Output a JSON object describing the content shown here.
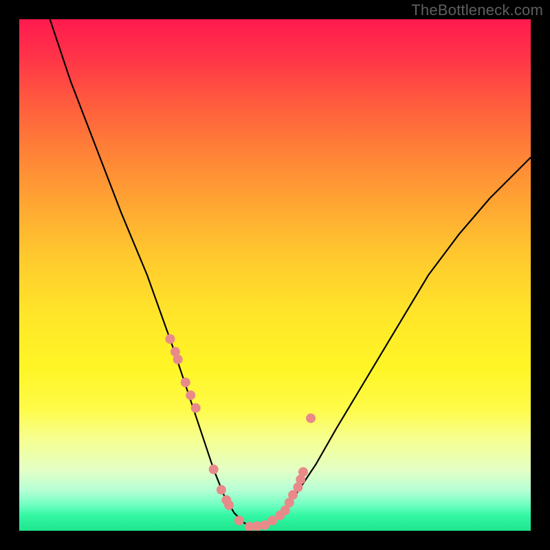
{
  "watermark": "TheBottleneck.com",
  "chart_data": {
    "type": "line",
    "title": "",
    "xlabel": "",
    "ylabel": "",
    "xlim": [
      0,
      100
    ],
    "ylim": [
      0,
      100
    ],
    "grid": false,
    "series": [
      {
        "name": "bottleneck-curve",
        "color": "#000000",
        "x": [
          6,
          10,
          15,
          20,
          25,
          30,
          32,
          34,
          36,
          38,
          40,
          42,
          44,
          46,
          48,
          50,
          54,
          58,
          62,
          68,
          74,
          80,
          86,
          92,
          98,
          100
        ],
        "y": [
          100,
          88,
          75,
          62,
          50,
          36,
          30,
          24,
          18,
          12,
          7,
          3.5,
          1.5,
          0.7,
          1.0,
          2.3,
          7,
          13,
          20,
          30,
          40,
          50,
          58,
          65,
          71,
          73
        ]
      }
    ],
    "markers": {
      "name": "highlighted-points",
      "color": "#e88a8a",
      "radius_px": 7,
      "x": [
        29.5,
        30.5,
        31.0,
        32.5,
        33.5,
        34.5,
        38.0,
        39.5,
        40.5,
        41.0,
        43.0,
        45.0,
        46.5,
        48.0,
        49.5,
        51.0,
        52.0,
        52.8,
        53.5,
        54.5,
        55.0,
        55.5,
        57.0
      ],
      "y": [
        37.5,
        35.0,
        33.5,
        29.0,
        26.5,
        24.0,
        12.0,
        8.0,
        6.0,
        5.0,
        2.0,
        0.8,
        0.9,
        1.1,
        2.0,
        3.0,
        4.0,
        5.5,
        7.0,
        8.5,
        10.0,
        11.5,
        22.0
      ]
    },
    "background": {
      "type": "vertical-gradient",
      "stops": [
        {
          "pos": 0.0,
          "color": "#ff1a4e"
        },
        {
          "pos": 0.07,
          "color": "#ff3249"
        },
        {
          "pos": 0.16,
          "color": "#ff5a3e"
        },
        {
          "pos": 0.25,
          "color": "#ff7e38"
        },
        {
          "pos": 0.35,
          "color": "#ffa233"
        },
        {
          "pos": 0.46,
          "color": "#ffc82e"
        },
        {
          "pos": 0.58,
          "color": "#ffe629"
        },
        {
          "pos": 0.68,
          "color": "#fff526"
        },
        {
          "pos": 0.76,
          "color": "#fffb47"
        },
        {
          "pos": 0.82,
          "color": "#f6ff8f"
        },
        {
          "pos": 0.88,
          "color": "#e4ffc4"
        },
        {
          "pos": 0.92,
          "color": "#b8ffd6"
        },
        {
          "pos": 0.95,
          "color": "#6effc0"
        },
        {
          "pos": 0.97,
          "color": "#34f7a4"
        },
        {
          "pos": 1.0,
          "color": "#1ee58e"
        }
      ]
    }
  }
}
